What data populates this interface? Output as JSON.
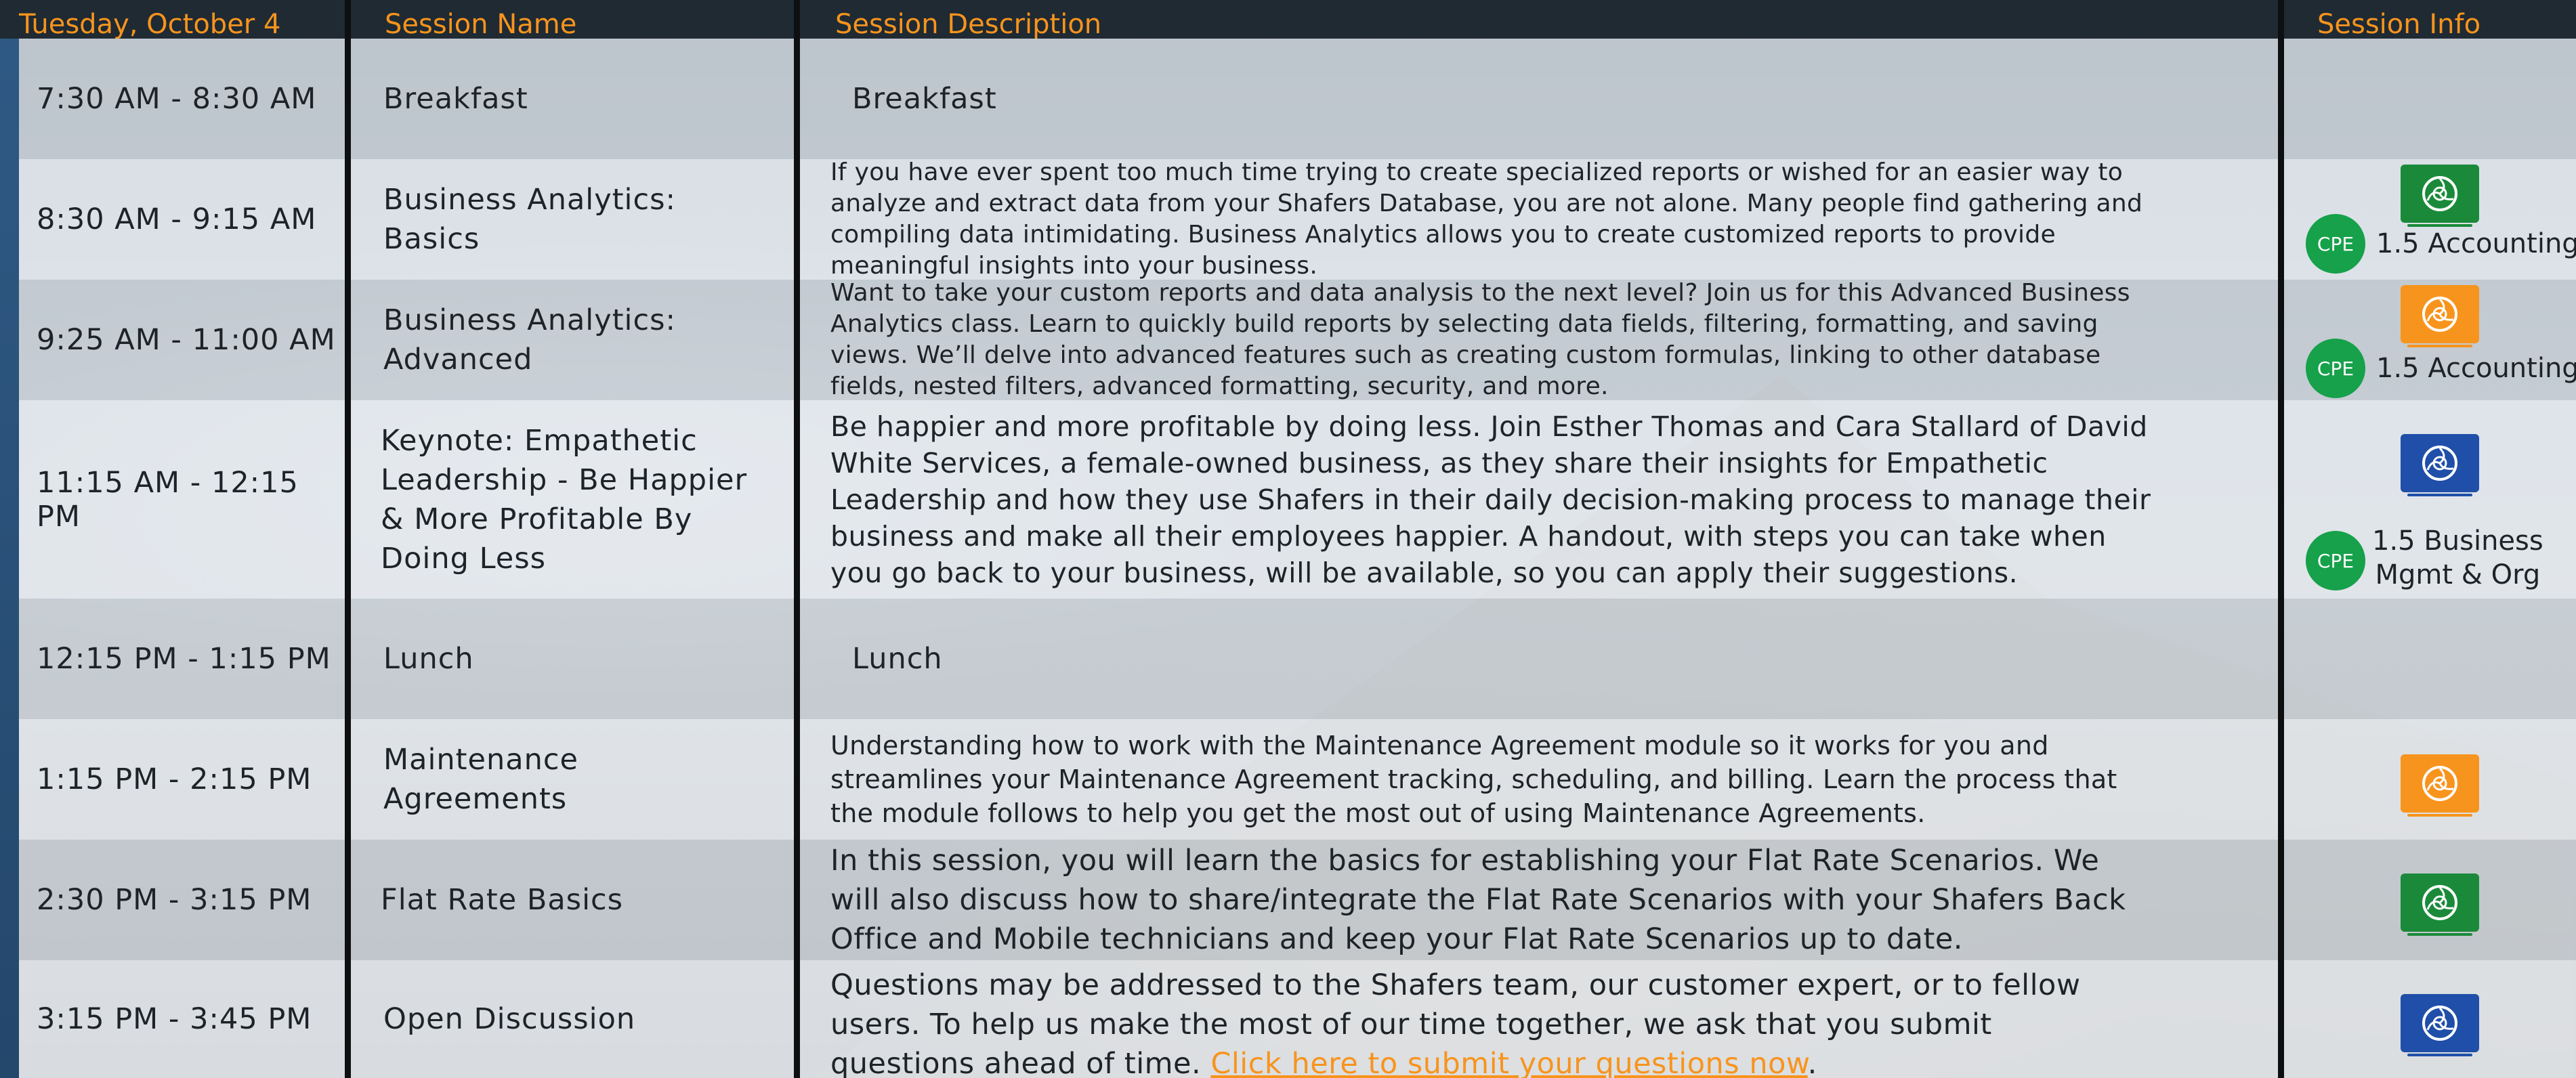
{
  "header": {
    "date": "Tuesday, October 4",
    "col_name": "Session Name",
    "col_desc": "Session Description",
    "col_info": "Session Info"
  },
  "colors": {
    "header_text": "#f7941d",
    "badge_green": "#1a8a3a",
    "badge_orange": "#f7941d",
    "badge_blue": "#1f4fa8",
    "cpe_green": "#16a14a",
    "link": "#f7941d"
  },
  "sessions": [
    {
      "time": "7:30 AM - 8:30 AM",
      "name": "Breakfast",
      "desc": "Breakfast"
    },
    {
      "time": "8:30 AM - 9:15 AM",
      "name_line1": "Business Analytics:",
      "name_line2": "Basics",
      "desc_lines": [
        "If you have ever spent too much time trying to create specialized reports or wished for an easier way to",
        "analyze and extract data from your Shafers Database, you are not alone. Many people find gathering and",
        "compiling data intimidating. Business Analytics allows you to create customized reports to provide",
        "meaningful insights into your business."
      ],
      "badge_icon": "shafers-logo-icon",
      "badge_color": "green",
      "cpe": "CPE",
      "credit": "1.5 Accounting"
    },
    {
      "time": "9:25 AM - 11:00 AM",
      "name_line1": "Business Analytics:",
      "name_line2": "Advanced",
      "desc_lines": [
        "Want to take your custom reports and data analysis to the next level?  Join us for this Advanced Business",
        "Analytics class. Learn to quickly build reports by selecting data fields, filtering, formatting, and saving",
        "views. We’ll delve into advanced features such as creating custom formulas, linking to other database",
        "fields, nested filters, advanced formatting, security, and more."
      ],
      "badge_icon": "shafers-logo-icon",
      "badge_color": "orange",
      "cpe": "CPE",
      "credit": "1.5 Accounting"
    },
    {
      "time": "11:15 AM - 12:15 PM",
      "name_lines": [
        "Keynote: Empathetic",
        "Leadership - Be Happier",
        "& More Profitable By",
        "Doing Less"
      ],
      "desc_lines": [
        "Be happier and more profitable by doing less. Join Esther Thomas and Cara Stallard of David",
        "White Services, a female-owned business, as they share their insights for Empathetic",
        "Leadership and how they use Shafers in their daily decision-making process to manage their",
        "business and make all their employees happier. A handout, with steps you can take when",
        "you go back to your business, will be available, so you can apply their suggestions."
      ],
      "badge_icon": "shafers-logo-icon",
      "badge_color": "blue",
      "cpe": "CPE",
      "credit_line1": "1.5 Business",
      "credit_line2": "Mgmt & Org"
    },
    {
      "time": "12:15 PM - 1:15 PM",
      "name": "Lunch",
      "desc": "Lunch"
    },
    {
      "time": "1:15 PM - 2:15 PM",
      "name_line1": "Maintenance",
      "name_line2": "Agreements",
      "desc_lines": [
        "Understanding how to work with the Maintenance Agreement module so it works for you and",
        "streamlines your Maintenance Agreement tracking, scheduling, and billing. Learn the process that",
        "the module follows to help you get the most out of using Maintenance Agreements."
      ],
      "badge_icon": "shafers-logo-icon",
      "badge_color": "orange"
    },
    {
      "time": "2:30 PM - 3:15 PM",
      "name": "Flat Rate Basics",
      "desc_lines": [
        "In this session, you will learn the basics for establishing your Flat Rate Scenarios. We",
        "will also discuss how to share/integrate the Flat Rate Scenarios with your Shafers Back",
        "Office and Mobile technicians and keep your Flat Rate Scenarios up to date."
      ],
      "badge_icon": "shafers-logo-icon",
      "badge_color": "green"
    },
    {
      "time": "3:15 PM - 3:45 PM",
      "name": "Open Discussion",
      "desc_lines": [
        "Questions may be addressed to the Shafers team, our customer expert, or to fellow",
        "users. To help us make the most of our time together, we ask that you submit",
        "questions ahead of time. "
      ],
      "desc_link": "Click here to submit your questions now",
      "desc_after_link": ".",
      "badge_icon": "shafers-logo-icon",
      "badge_color": "blue"
    }
  ]
}
